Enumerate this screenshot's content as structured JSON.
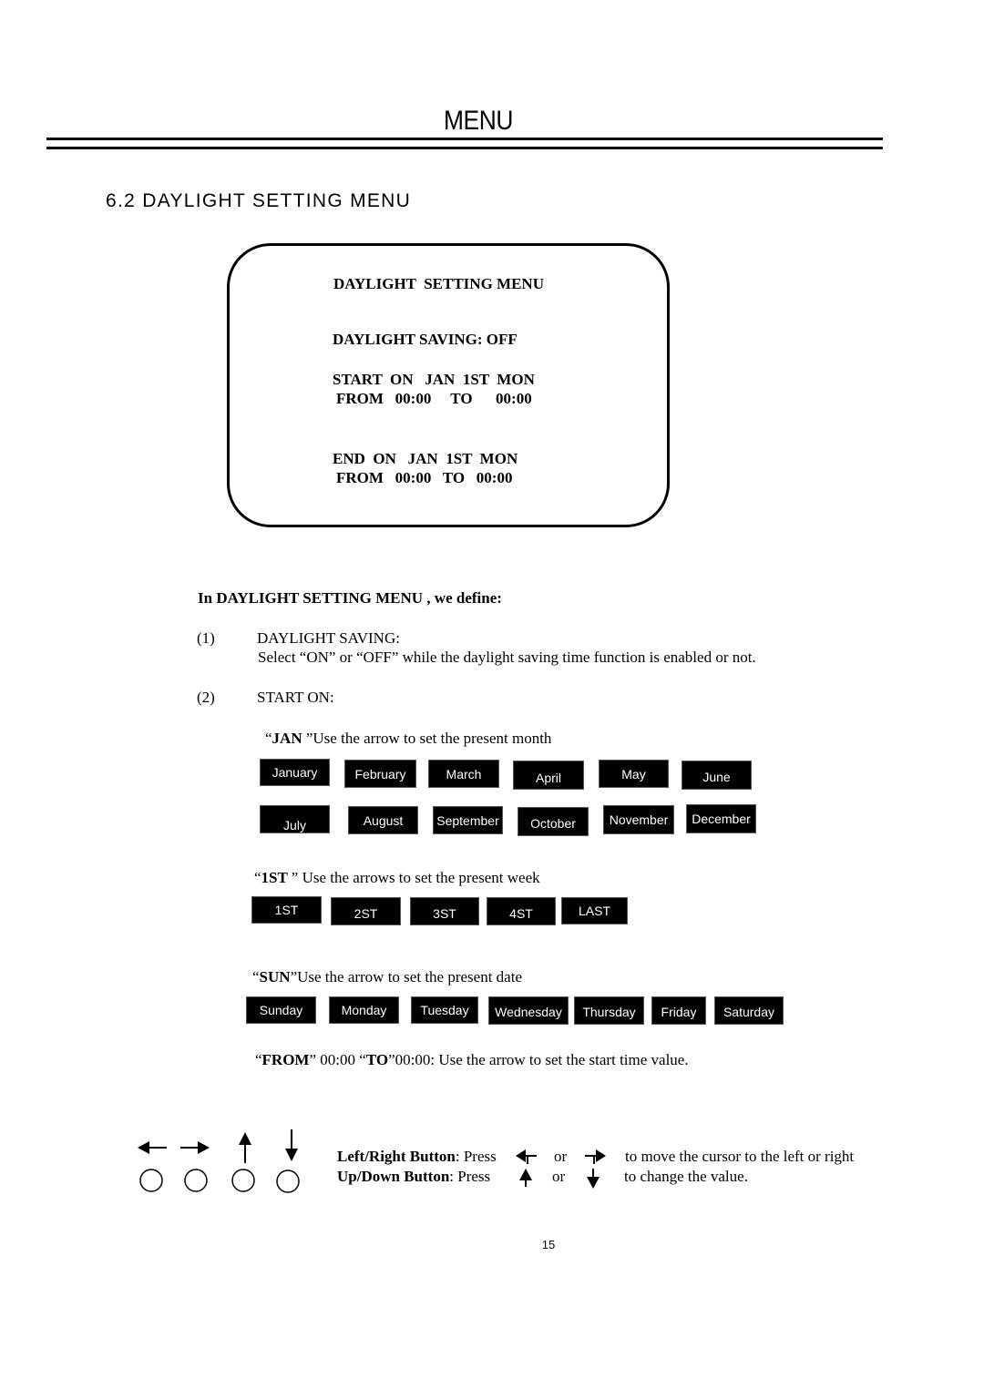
{
  "header": {
    "title": "MENU"
  },
  "section": {
    "title": "6.2 DAYLIGHT SETTING MENU"
  },
  "osd": {
    "title": "DAYLIGHT  SETTING MENU",
    "daylight_saving": "DAYLIGHT SAVING: OFF",
    "start_on": "START  ON   JAN  1ST  MON",
    "start_from": "FROM   00:00     TO      00:00",
    "end_on": "END  ON   JAN  1ST  MON",
    "end_from": "FROM   00:00   TO   00:00"
  },
  "intro": "In DAYLIGHT  SETTING MENU , we define:",
  "items": [
    {
      "number": "(1)",
      "label": "DAYLIGHT SAVING:",
      "description": "Select “ON” or “OFF” while the daylight saving time function is enabled or not."
    },
    {
      "number": "(2)",
      "label": "START ON:"
    }
  ],
  "month_hint": {
    "keyword": "JAN ",
    "text": "Use the arrow to set the present month"
  },
  "months": [
    "January",
    "February",
    "March",
    "April",
    "May",
    "June",
    "July",
    "August",
    "September",
    "October",
    "November",
    "December"
  ],
  "week_hint": {
    "keyword": "1ST ",
    "text": " Use the arrows to set the present week"
  },
  "weeks": [
    "1ST",
    "2ST",
    "3ST",
    "4ST",
    "LAST"
  ],
  "day_hint": {
    "keyword": "SUN",
    "text": "Use the arrow to set the present date"
  },
  "days": [
    "Sunday",
    "Monday",
    "Tuesday",
    "Wednesday",
    "Thursday",
    "Friday",
    "Saturday"
  ],
  "time_hint": {
    "from_kw": "FROM",
    "from_val": " 00:00 ",
    "to_kw": "TO",
    "to_val": "00:00: Use the arrow to set the start time value."
  },
  "buttons": {
    "icons": [
      "left-arrow",
      "right-arrow",
      "up-arrow",
      "down-arrow"
    ],
    "lr_label": "Left/Right Button",
    "lr_press": ": Press",
    "or": "or",
    "lr_desc": "to move the cursor to the left or right",
    "ud_label": "Up/Down Button",
    "ud_press": ": Press",
    "ud_desc": "to change the value."
  },
  "page_number": "15"
}
